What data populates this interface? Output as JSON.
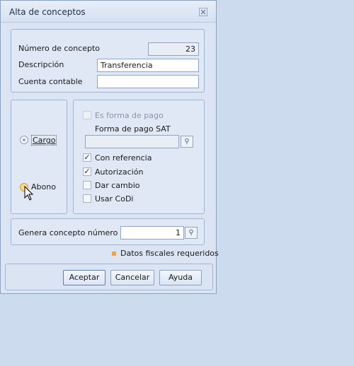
{
  "window": {
    "title": "Alta de conceptos",
    "close_glyph": "✕"
  },
  "fields": {
    "numero_label": "Número de concepto",
    "numero_value": "23",
    "descripcion_label": "Descripción",
    "descripcion_value": "Transferencia",
    "cuenta_label": "Cuenta contable",
    "cuenta_value": ""
  },
  "tipo": {
    "cargo_label": "Cargo",
    "abono_label": "Abono"
  },
  "options": {
    "forma_pago_label": "Es forma de pago",
    "forma_pago_sat_label": "Forma de pago SAT",
    "forma_pago_sat_value": "",
    "con_referencia_label": "Con referencia",
    "autorizacion_label": "Autorización",
    "dar_cambio_label": "Dar cambio",
    "usar_codi_label": "Usar CoDi",
    "check_mark": "✓"
  },
  "genera": {
    "label": "Genera concepto número",
    "value": "1"
  },
  "legend": {
    "text": "Datos fiscales requeridos",
    "color": "#f0a63a"
  },
  "buttons": {
    "aceptar": "Aceptar",
    "cancelar": "Cancelar",
    "ayuda": "Ayuda"
  },
  "icons": {
    "lookup": "search-icon"
  }
}
